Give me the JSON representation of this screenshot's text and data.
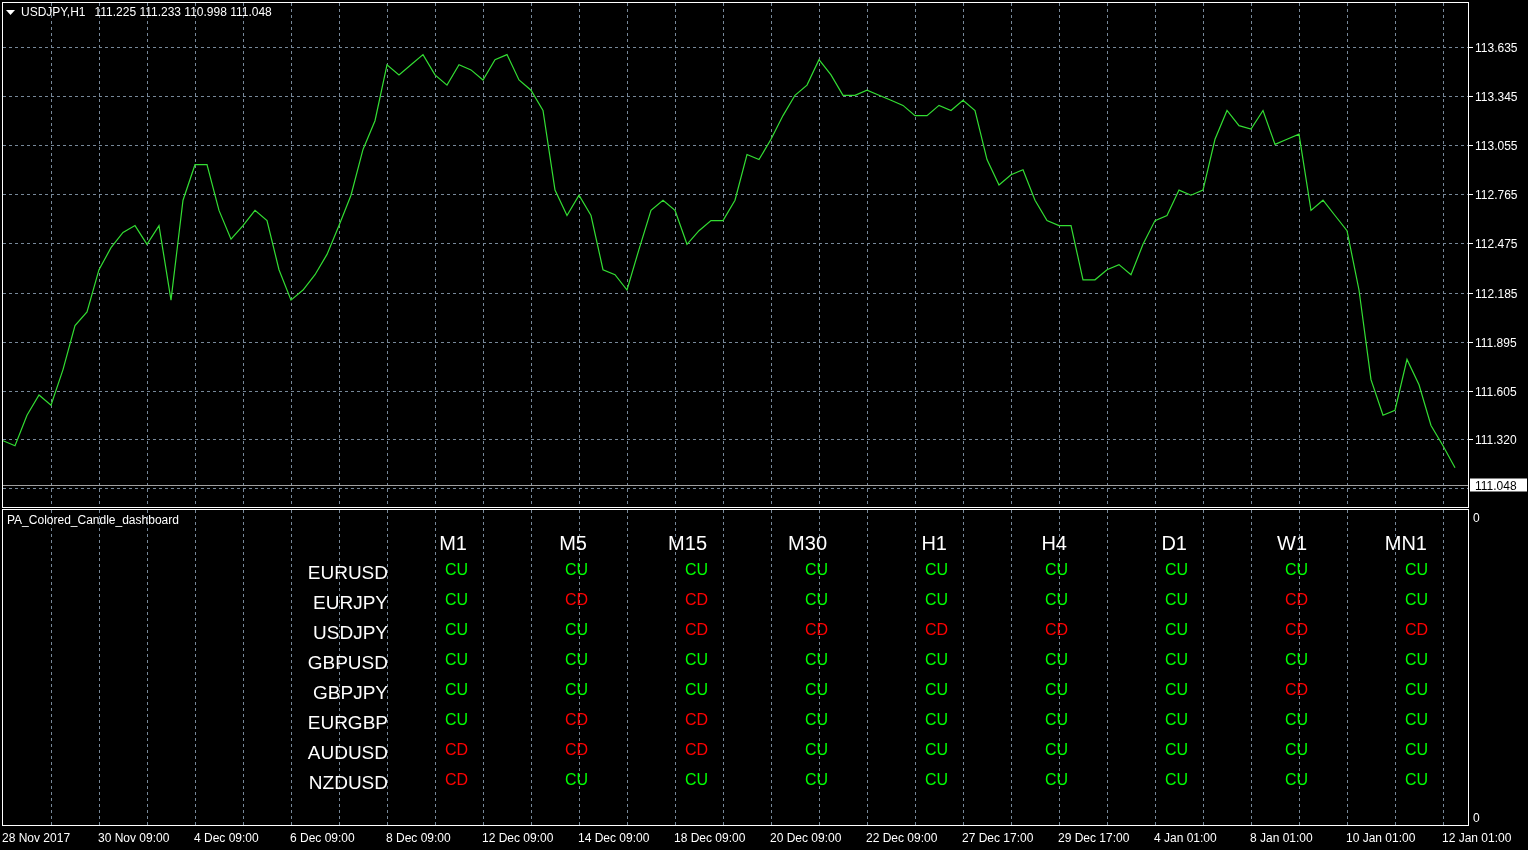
{
  "chart": {
    "symbol": "USDJPY,H1",
    "quote": "111.225 111.233 110.998 111.048",
    "chart_data": {
      "type": "line",
      "grid": true,
      "ylim": [
        110.9125,
        113.9007
      ],
      "yticks": [
        {
          "value": 113.635,
          "label": "113.635"
        },
        {
          "value": 113.345,
          "label": "113.345"
        },
        {
          "value": 113.055,
          "label": "113.055"
        },
        {
          "value": 112.765,
          "label": "112.765"
        },
        {
          "value": 112.475,
          "label": "112.475"
        },
        {
          "value": 112.185,
          "label": "112.185"
        },
        {
          "value": 111.895,
          "label": "111.895"
        },
        {
          "value": 111.605,
          "label": "111.605"
        },
        {
          "value": 111.32,
          "label": "111.320"
        }
      ],
      "series": [
        {
          "color": "#33dd33",
          "values": [
            111.31,
            111.28,
            111.46,
            111.58,
            111.52,
            111.73,
            111.99,
            112.07,
            112.32,
            112.45,
            112.54,
            112.58,
            112.47,
            112.58,
            112.14,
            112.73,
            112.94,
            112.94,
            112.67,
            112.5,
            112.58,
            112.67,
            112.61,
            112.32,
            112.14,
            112.2,
            112.29,
            112.41,
            112.58,
            112.76,
            113.03,
            113.2,
            113.53,
            113.47,
            113.53,
            113.59,
            113.47,
            113.41,
            113.53,
            113.5,
            113.44,
            113.56,
            113.59,
            113.44,
            113.38,
            113.26,
            112.79,
            112.64,
            112.76,
            112.64,
            112.32,
            112.29,
            112.2,
            112.44,
            112.67,
            112.73,
            112.67,
            112.47,
            112.55,
            112.61,
            112.61,
            112.73,
            113.0,
            112.97,
            113.09,
            113.23,
            113.35,
            113.41,
            113.56,
            113.47,
            113.35,
            113.35,
            113.38,
            113.35,
            113.32,
            113.29,
            113.23,
            113.23,
            113.29,
            113.26,
            113.32,
            113.26,
            112.97,
            112.82,
            112.88,
            112.91,
            112.73,
            112.61,
            112.58,
            112.58,
            112.26,
            112.26,
            112.32,
            112.35,
            112.29,
            112.47,
            112.61,
            112.64,
            112.79,
            112.76,
            112.79,
            113.09,
            113.26,
            113.17,
            113.15,
            113.26,
            113.06,
            113.09,
            113.12,
            112.67,
            112.73,
            112.64,
            112.55,
            112.2,
            111.67,
            111.46,
            111.49,
            111.79,
            111.64,
            111.4,
            111.28,
            111.15
          ]
        }
      ],
      "ref_lines": [
        {
          "axis": "y",
          "value": 111.048,
          "label": "111.048"
        }
      ]
    },
    "time_axis": [
      "28 Nov 2017",
      "30 Nov 09:00",
      "4 Dec 09:00",
      "6 Dec 09:00",
      "8 Dec 09:00",
      "12 Dec 09:00",
      "14 Dec 09:00",
      "18 Dec 09:00",
      "20 Dec 09:00",
      "22 Dec 09:00",
      "27 Dec 17:00",
      "29 Dec 17:00",
      "4 Jan 01:00",
      "8 Jan 01:00",
      "10 Jan 01:00",
      "12 Jan 01:00"
    ]
  },
  "indicator": {
    "title": "PA_Colored_Candle_dashboard",
    "axis_labels": [
      "0",
      "0"
    ],
    "dashboard": {
      "columns": [
        "M1",
        "M5",
        "M15",
        "M30",
        "H1",
        "H4",
        "D1",
        "W1",
        "MN1"
      ],
      "rows": [
        {
          "symbol": "EURUSD",
          "cells": [
            {
              "text": "CU",
              "color": "#00ff00"
            },
            {
              "text": "CU",
              "color": "#00ff00"
            },
            {
              "text": "CU",
              "color": "#00ff00"
            },
            {
              "text": "CU",
              "color": "#00ff00"
            },
            {
              "text": "CU",
              "color": "#00ff00"
            },
            {
              "text": "CU",
              "color": "#00ff00"
            },
            {
              "text": "CU",
              "color": "#00ff00"
            },
            {
              "text": "CU",
              "color": "#00ff00"
            },
            {
              "text": "CU",
              "color": "#00ff00"
            }
          ]
        },
        {
          "symbol": "EURJPY",
          "cells": [
            {
              "text": "CU",
              "color": "#00ff00"
            },
            {
              "text": "CD",
              "color": "#ff0000"
            },
            {
              "text": "CD",
              "color": "#ff0000"
            },
            {
              "text": "CU",
              "color": "#00ff00"
            },
            {
              "text": "CU",
              "color": "#00ff00"
            },
            {
              "text": "CU",
              "color": "#00ff00"
            },
            {
              "text": "CU",
              "color": "#00ff00"
            },
            {
              "text": "CD",
              "color": "#ff0000"
            },
            {
              "text": "CU",
              "color": "#00ff00"
            }
          ]
        },
        {
          "symbol": "USDJPY",
          "cells": [
            {
              "text": "CU",
              "color": "#00ff00"
            },
            {
              "text": "CU",
              "color": "#00ff00"
            },
            {
              "text": "CD",
              "color": "#ff0000"
            },
            {
              "text": "CD",
              "color": "#ff0000"
            },
            {
              "text": "CD",
              "color": "#ff0000"
            },
            {
              "text": "CD",
              "color": "#ff0000"
            },
            {
              "text": "CU",
              "color": "#00ff00"
            },
            {
              "text": "CD",
              "color": "#ff0000"
            },
            {
              "text": "CD",
              "color": "#ff0000"
            }
          ]
        },
        {
          "symbol": "GBPUSD",
          "cells": [
            {
              "text": "CU",
              "color": "#00ff00"
            },
            {
              "text": "CU",
              "color": "#00ff00"
            },
            {
              "text": "CU",
              "color": "#00ff00"
            },
            {
              "text": "CU",
              "color": "#00ff00"
            },
            {
              "text": "CU",
              "color": "#00ff00"
            },
            {
              "text": "CU",
              "color": "#00ff00"
            },
            {
              "text": "CU",
              "color": "#00ff00"
            },
            {
              "text": "CU",
              "color": "#00ff00"
            },
            {
              "text": "CU",
              "color": "#00ff00"
            }
          ]
        },
        {
          "symbol": "GBPJPY",
          "cells": [
            {
              "text": "CU",
              "color": "#00ff00"
            },
            {
              "text": "CU",
              "color": "#00ff00"
            },
            {
              "text": "CU",
              "color": "#00ff00"
            },
            {
              "text": "CU",
              "color": "#00ff00"
            },
            {
              "text": "CU",
              "color": "#00ff00"
            },
            {
              "text": "CU",
              "color": "#00ff00"
            },
            {
              "text": "CU",
              "color": "#00ff00"
            },
            {
              "text": "CD",
              "color": "#ff0000"
            },
            {
              "text": "CU",
              "color": "#00ff00"
            }
          ]
        },
        {
          "symbol": "EURGBP",
          "cells": [
            {
              "text": "CU",
              "color": "#00ff00"
            },
            {
              "text": "CD",
              "color": "#ff0000"
            },
            {
              "text": "CD",
              "color": "#ff0000"
            },
            {
              "text": "CU",
              "color": "#00ff00"
            },
            {
              "text": "CU",
              "color": "#00ff00"
            },
            {
              "text": "CU",
              "color": "#00ff00"
            },
            {
              "text": "CU",
              "color": "#00ff00"
            },
            {
              "text": "CU",
              "color": "#00ff00"
            },
            {
              "text": "CU",
              "color": "#00ff00"
            }
          ]
        },
        {
          "symbol": "AUDUSD",
          "cells": [
            {
              "text": "CD",
              "color": "#ff0000"
            },
            {
              "text": "CD",
              "color": "#ff0000"
            },
            {
              "text": "CD",
              "color": "#ff0000"
            },
            {
              "text": "CU",
              "color": "#00ff00"
            },
            {
              "text": "CU",
              "color": "#00ff00"
            },
            {
              "text": "CU",
              "color": "#00ff00"
            },
            {
              "text": "CU",
              "color": "#00ff00"
            },
            {
              "text": "CU",
              "color": "#00ff00"
            },
            {
              "text": "CU",
              "color": "#00ff00"
            }
          ]
        },
        {
          "symbol": "NZDUSD",
          "cells": [
            {
              "text": "CD",
              "color": "#ff0000"
            },
            {
              "text": "CU",
              "color": "#00ff00"
            },
            {
              "text": "CU",
              "color": "#00ff00"
            },
            {
              "text": "CU",
              "color": "#00ff00"
            },
            {
              "text": "CU",
              "color": "#00ff00"
            },
            {
              "text": "CU",
              "color": "#00ff00"
            },
            {
              "text": "CU",
              "color": "#00ff00"
            },
            {
              "text": "CU",
              "color": "#00ff00"
            },
            {
              "text": "CU",
              "color": "#00ff00"
            }
          ]
        }
      ]
    }
  }
}
